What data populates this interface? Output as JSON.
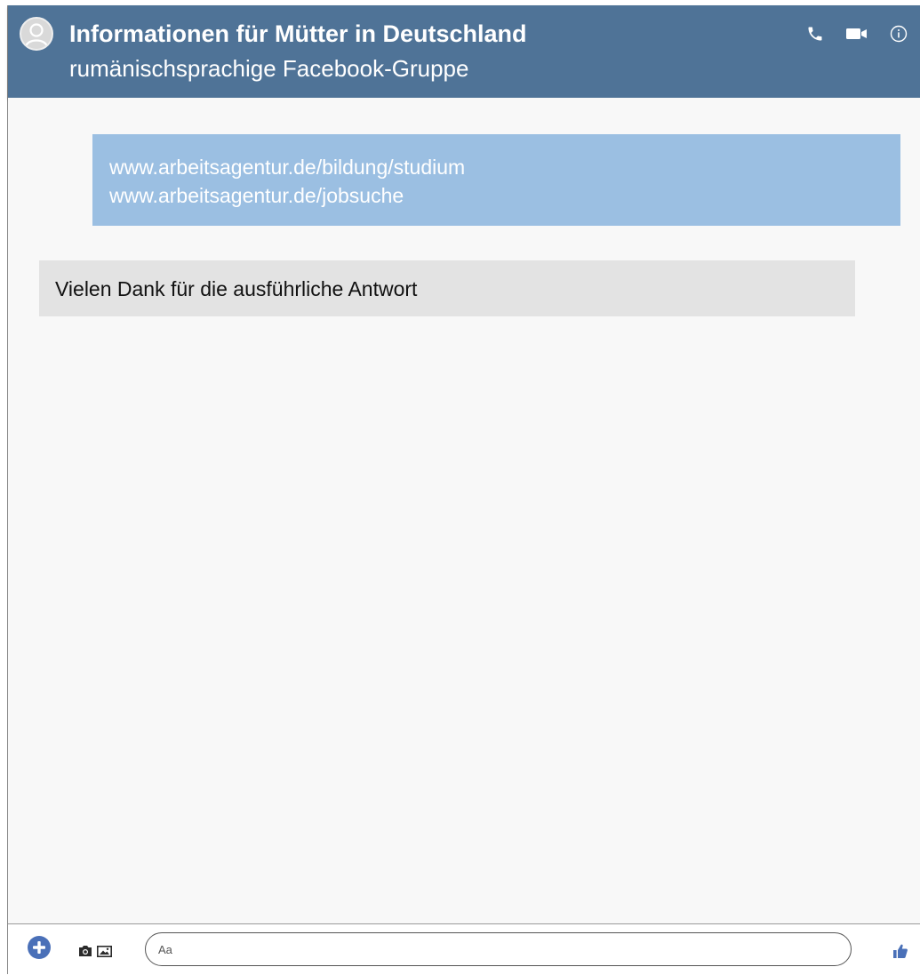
{
  "header": {
    "title": "Informationen für Mütter in Deutschland",
    "subtitle": "rumänischsprachige Facebook-Gruppe",
    "icons": [
      "phone-icon",
      "video-camera-icon",
      "info-icon"
    ]
  },
  "messages": [
    {
      "direction": "sent",
      "lines": [
        "www.arbeitsagentur.de/bildung/studium",
        "www.arbeitsagentur.de/jobsuche"
      ]
    },
    {
      "direction": "received",
      "lines": [
        "Vielen Dank für die ausführliche Antwort"
      ]
    }
  ],
  "composer": {
    "placeholder": "Aa",
    "icons": [
      "plus-icon",
      "camera-icon",
      "gallery-icon",
      "thumbs-up-icon"
    ]
  },
  "colors": {
    "header_bg": "#4f7397",
    "sent_bubble": "#9bbfe2",
    "received_bubble": "#e3e3e3",
    "accent": "#4a70b8"
  }
}
